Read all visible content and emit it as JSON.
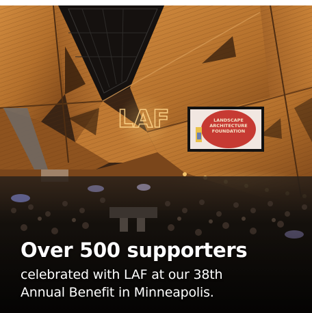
{
  "caption": {
    "headline": "Over 500 supporters",
    "line1": "celebrated with LAF at our 38th",
    "line2": "Annual Benefit in Minneapolis."
  },
  "projection": {
    "wall_letters": "LAF",
    "screen_line1": "LANDSCAPE",
    "screen_line2": "ARCHITECTURE",
    "screen_line3": "FOUNDATION"
  },
  "colors": {
    "wood": "#b4702c",
    "wood_dark": "#6b3c15",
    "crowd": "#15110d",
    "screen_red": "#c63a33",
    "text": "#ffffff"
  },
  "icons": [
    "ceiling-skylight",
    "projection-screen",
    "laf-logo-projection"
  ]
}
